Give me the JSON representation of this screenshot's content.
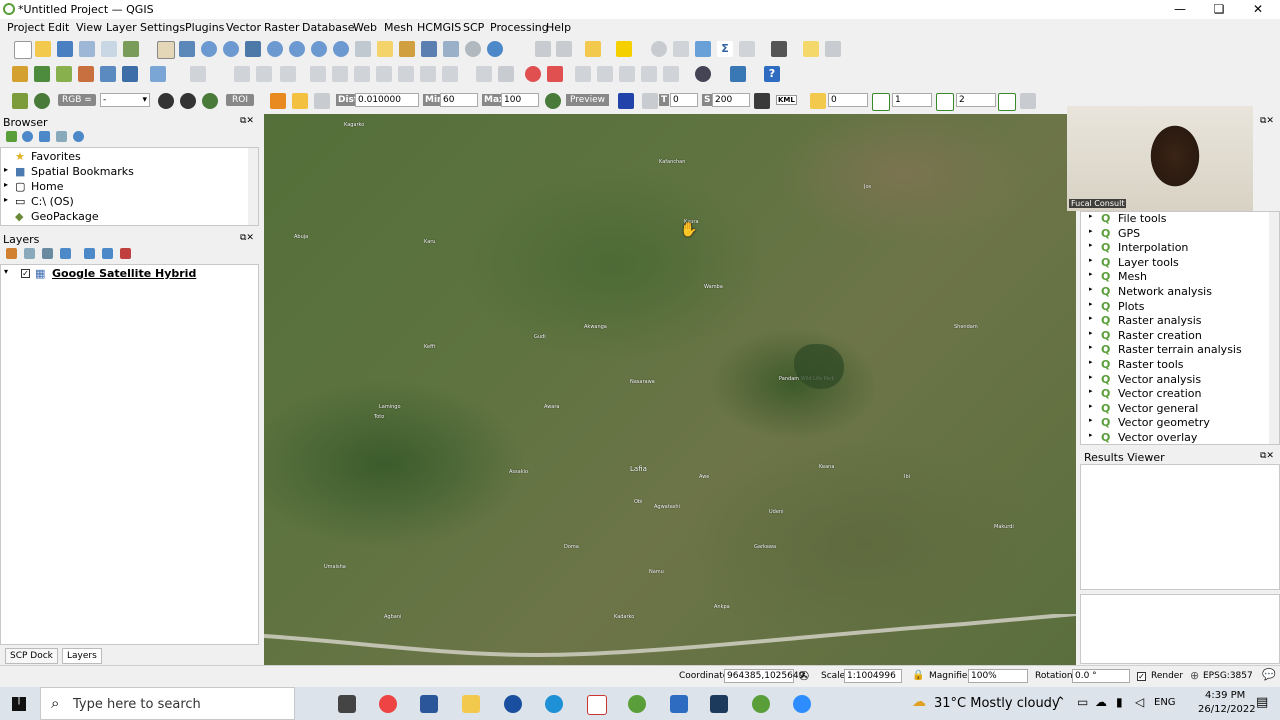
{
  "window": {
    "title": "*Untitled Project — QGIS"
  },
  "menu": [
    "Project",
    "Edit",
    "View",
    "Layer",
    "Settings",
    "Plugins",
    "Vector",
    "Raster",
    "Database",
    "Web",
    "Mesh",
    "HCMGIS",
    "SCP",
    "Processing",
    "Help"
  ],
  "scp_toolbar": {
    "rgb_label": "RGB =",
    "rgb_value": "-",
    "roi_label": "ROI",
    "dist_label": "Dist",
    "dist_value": "0.010000",
    "min_label": "Min",
    "min_value": "60",
    "max_label": "Max",
    "max_value": "100",
    "preview_label": "Preview",
    "t_label": "T",
    "t_value": "0",
    "s_label": "S",
    "s_value": "200",
    "kml_label": "KML",
    "v1": "0",
    "v2": "1",
    "v3": "2"
  },
  "browser": {
    "title": "Browser",
    "items": [
      "Favorites",
      "Spatial Bookmarks",
      "Home",
      "C:\\ (OS)",
      "GeoPackage"
    ]
  },
  "layers": {
    "title": "Layers",
    "items": [
      {
        "name": "Google Satellite Hybrid",
        "checked": true
      }
    ]
  },
  "bottom_tabs": [
    "SCP Dock",
    "Layers"
  ],
  "processing": {
    "items": [
      "File tools",
      "GPS",
      "Interpolation",
      "Layer tools",
      "Mesh",
      "Network analysis",
      "Plots",
      "Raster analysis",
      "Raster creation",
      "Raster terrain analysis",
      "Raster tools",
      "Vector analysis",
      "Vector creation",
      "Vector general",
      "Vector geometry",
      "Vector overlay"
    ]
  },
  "results_viewer": {
    "title": "Results Viewer"
  },
  "webcam": {
    "label": "Fucal Consult"
  },
  "map_labels": [
    "Kagarko",
    "Gudi",
    "Kaura",
    "Kafanchan",
    "Makurdi",
    "Lafia",
    "Doma",
    "Obi",
    "Nasarawa",
    "Akwanga",
    "Keffi",
    "Awe",
    "Wamba",
    "Agwatashi",
    "Assakio",
    "Udeni",
    "Ibi",
    "Shendam",
    "Namu",
    "Garkawa",
    "Jos",
    "Awara",
    "Keana",
    "Toto",
    "Umaisha",
    "Agbani",
    "Kadarko",
    "Ankpa",
    "Pandam Wild Life Park",
    "Abuja",
    "Karu",
    "Lamingo"
  ],
  "status": {
    "coordinate_label": "Coordinate",
    "coordinate_value": "964385,1025649",
    "scale_label": "Scale",
    "scale_value": "1:1004996",
    "magnifier_label": "Magnifier",
    "magnifier_value": "100%",
    "rotation_label": "Rotation",
    "rotation_value": "0.0 °",
    "render_label": "Render",
    "crs": "EPSG:3857"
  },
  "taskbar": {
    "search_placeholder": "Type here to search",
    "weather": "31°C  Mostly cloudy",
    "lang": "ENG",
    "time": "4:39 PM",
    "date": "26/12/2022"
  },
  "colors": {
    "qgis_green": "#5a9e3a",
    "map_base": "#5e7340",
    "accent": "#1e6fd9"
  }
}
